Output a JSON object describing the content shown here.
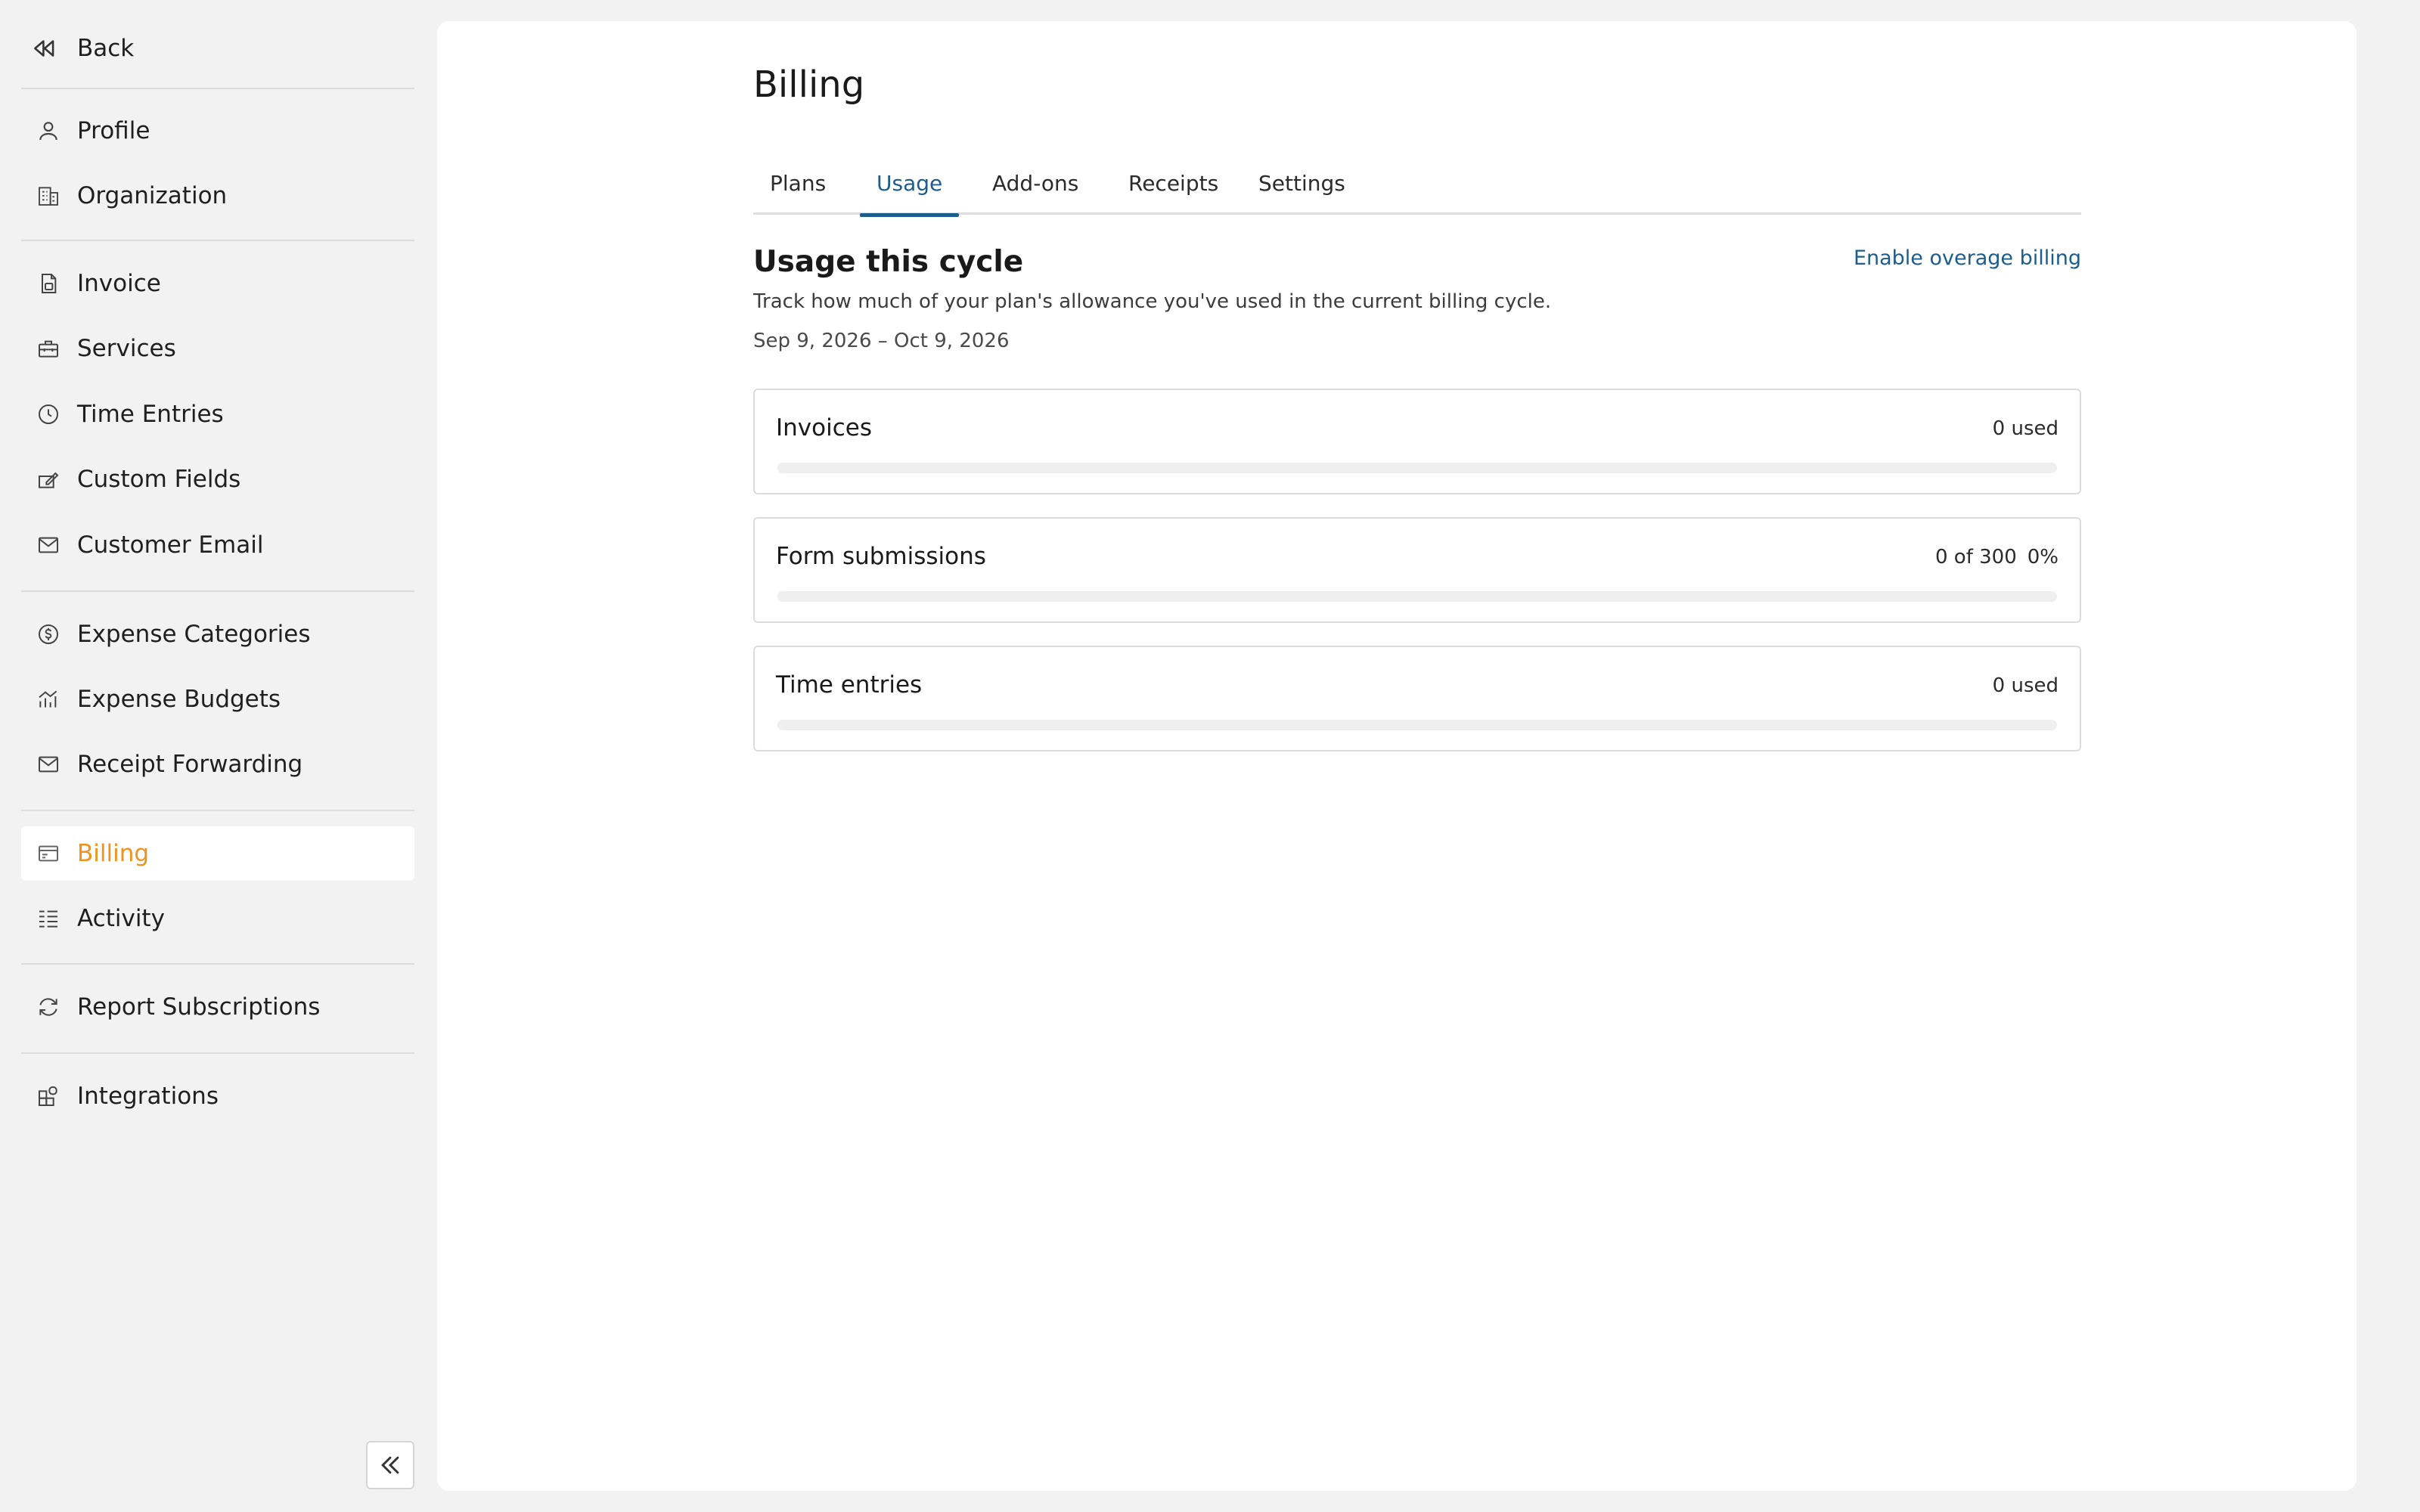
{
  "sidebar": {
    "back_label": "Back",
    "items": [
      {
        "label": "Profile",
        "icon": "user-icon"
      },
      {
        "label": "Organization",
        "icon": "building-icon"
      },
      {
        "label": "Invoice",
        "icon": "document-icon"
      },
      {
        "label": "Services",
        "icon": "toolbox-icon"
      },
      {
        "label": "Time Entries",
        "icon": "clock-icon"
      },
      {
        "label": "Custom Fields",
        "icon": "edit-field-icon"
      },
      {
        "label": "Customer Email",
        "icon": "mail-icon"
      },
      {
        "label": "Expense Categories",
        "icon": "coin-icon"
      },
      {
        "label": "Expense Budgets",
        "icon": "chart-icon"
      },
      {
        "label": "Receipt Forwarding",
        "icon": "mail-icon"
      },
      {
        "label": "Billing",
        "icon": "credit-card-icon",
        "active": true
      },
      {
        "label": "Activity",
        "icon": "list-icon"
      },
      {
        "label": "Report Subscriptions",
        "icon": "refresh-icon"
      },
      {
        "label": "Integrations",
        "icon": "puzzle-icon"
      }
    ],
    "active_color": "#f0921b"
  },
  "billing": {
    "title": "Billing",
    "tabs": [
      {
        "label": "Plans"
      },
      {
        "label": "Usage",
        "active": true
      },
      {
        "label": "Add-ons"
      },
      {
        "label": "Receipts"
      },
      {
        "label": "Settings"
      }
    ],
    "accent_color": "#1d5d8c"
  },
  "usage": {
    "title": "Usage this cycle",
    "enable_link": "Enable overage billing",
    "description": "Track how much of your plan's allowance you've used in the current billing cycle.",
    "cycle_range": "Sep 9, 2026 – Oct 9, 2026",
    "items": [
      {
        "name": "Invoices",
        "meta": "0 used",
        "percent_label": "",
        "fraction": 0
      },
      {
        "name": "Form submissions",
        "meta": "0 of 300",
        "percent_label": "0%",
        "fraction": 0
      },
      {
        "name": "Time entries",
        "meta": "0 used",
        "percent_label": "",
        "fraction": 0
      }
    ]
  }
}
